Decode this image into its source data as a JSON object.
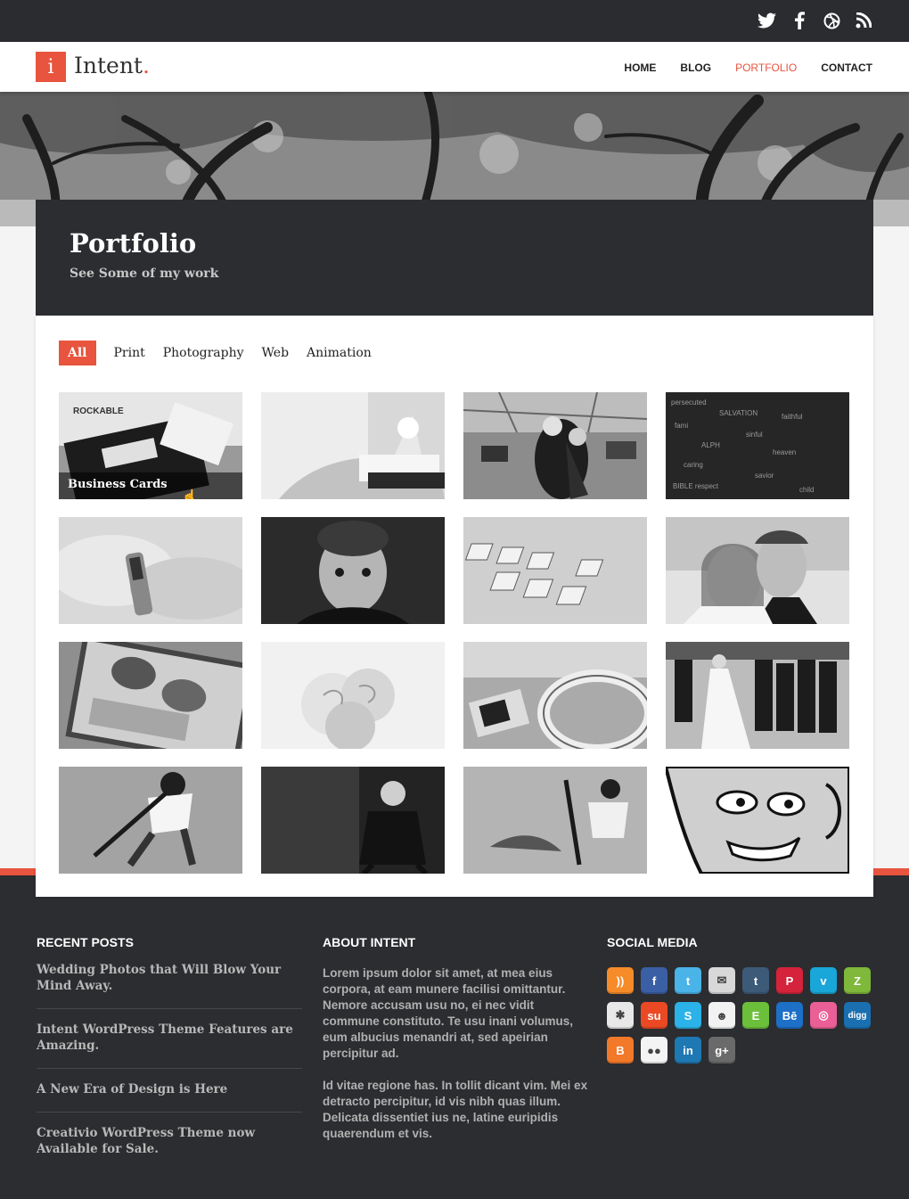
{
  "site": {
    "logo_letter": "i",
    "logo_name": "Intent",
    "logo_dot": "."
  },
  "top_social": [
    "twitter-icon",
    "facebook-icon",
    "dribbble-icon",
    "rss-icon"
  ],
  "nav": [
    {
      "label": "HOME",
      "active": false
    },
    {
      "label": "BLOG",
      "active": false
    },
    {
      "label": "PORTFOLIO",
      "active": true
    },
    {
      "label": "CONTACT",
      "active": false
    }
  ],
  "page": {
    "title": "Portfolio",
    "subtitle": "See Some of my work"
  },
  "filters": [
    {
      "label": "All",
      "active": true
    },
    {
      "label": "Print",
      "active": false
    },
    {
      "label": "Photography",
      "active": false
    },
    {
      "label": "Web",
      "active": false
    },
    {
      "label": "Animation",
      "active": false
    }
  ],
  "portfolio": {
    "hover_caption": "Business Cards"
  },
  "footer": {
    "recent_posts": {
      "heading": "RECENT POSTS",
      "items": [
        "Wedding Photos that Will Blow Your Mind Away.",
        "Intent WordPress Theme Features are Amazing.",
        "A New Era of Design is Here",
        "Creativio WordPress Theme now Available for Sale."
      ]
    },
    "about": {
      "heading": "ABOUT INTENT",
      "paragraphs": [
        "Lorem ipsum dolor sit amet, at mea eius corpora, at eam munere facilisi omittantur. Nemore accusam usu no, ei nec vidit commune constituto. Te usu inani volumus, eum albucius menandri at, sed apeirian percipitur ad.",
        "Id vitae regione has. In tollit dicant vim. Mei ex detracto percipitur, id vis nibh quas illum. Delicata dissentiet ius ne, latine euripidis quaerendum et vis."
      ]
    },
    "social": {
      "heading": "SOCIAL MEDIA",
      "icons": [
        {
          "name": "rss-icon",
          "glyph": "))",
          "color": "#f58b29"
        },
        {
          "name": "facebook-icon",
          "glyph": "f",
          "color": "#3b5fa5"
        },
        {
          "name": "twitter-icon",
          "glyph": "t",
          "color": "#4ab3e8"
        },
        {
          "name": "email-icon",
          "glyph": "✉",
          "color": "#d8d8d8"
        },
        {
          "name": "tumblr-icon",
          "glyph": "t",
          "color": "#3d5a78"
        },
        {
          "name": "pinterest-icon",
          "glyph": "P",
          "color": "#d4233a"
        },
        {
          "name": "vimeo-icon",
          "glyph": "v",
          "color": "#19a6d8"
        },
        {
          "name": "zerply-icon",
          "glyph": "Z",
          "color": "#7fb83a"
        },
        {
          "name": "picasa-icon",
          "glyph": "✱",
          "color": "#e8e8e8"
        },
        {
          "name": "stumbleupon-icon",
          "glyph": "su",
          "color": "#eb4924"
        },
        {
          "name": "skype-icon",
          "glyph": "S",
          "color": "#2bb2e8"
        },
        {
          "name": "reddit-icon",
          "glyph": "☻",
          "color": "#f2f2f2"
        },
        {
          "name": "evernote-icon",
          "glyph": "E",
          "color": "#6bbf3b"
        },
        {
          "name": "behance-icon",
          "glyph": "Bē",
          "color": "#1d6fc7"
        },
        {
          "name": "dribbble-icon",
          "glyph": "◎",
          "color": "#ea5f96"
        },
        {
          "name": "digg-icon",
          "glyph": "digg",
          "color": "#1a6fb0"
        },
        {
          "name": "blogger-icon",
          "glyph": "B",
          "color": "#f2782a"
        },
        {
          "name": "flickr-icon",
          "glyph": "●●",
          "color": "#f4f4f4"
        },
        {
          "name": "linkedin-icon",
          "glyph": "in",
          "color": "#1e78b4"
        },
        {
          "name": "googleplus-icon",
          "glyph": "g+",
          "color": "#6a6a6a"
        }
      ]
    }
  }
}
